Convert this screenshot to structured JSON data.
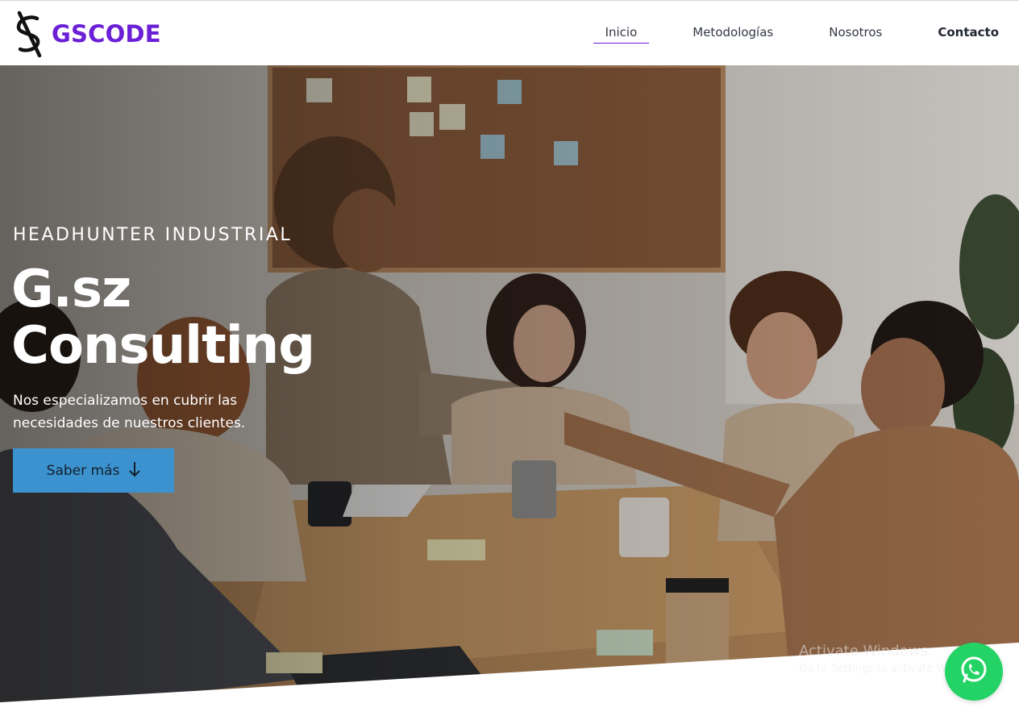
{
  "header": {
    "brand": "GSCODE",
    "nav": [
      {
        "label": "Inicio"
      },
      {
        "label": "Metodologías"
      },
      {
        "label": "Nosotros"
      },
      {
        "label": "Contacto"
      }
    ]
  },
  "hero": {
    "eyebrow": "HEADHUNTER INDUSTRIAL",
    "title_line1": "G.sz",
    "title_line2": "Consulting",
    "description": "Nos especializamos en cubrir las necesidades de nuestros clientes.",
    "cta_label": "Saber más"
  },
  "os_overlay": {
    "line1": "Activate Windows",
    "line2": "Go to Settings to activate Windows."
  },
  "icons": {
    "logo": "gscode-logo-icon",
    "cta_arrow": "arrow-down-icon",
    "chat": "whatsapp-icon"
  },
  "colors": {
    "brand": "#6b1fd6",
    "cta": "#3b92cf",
    "whatsapp": "#24d366"
  }
}
